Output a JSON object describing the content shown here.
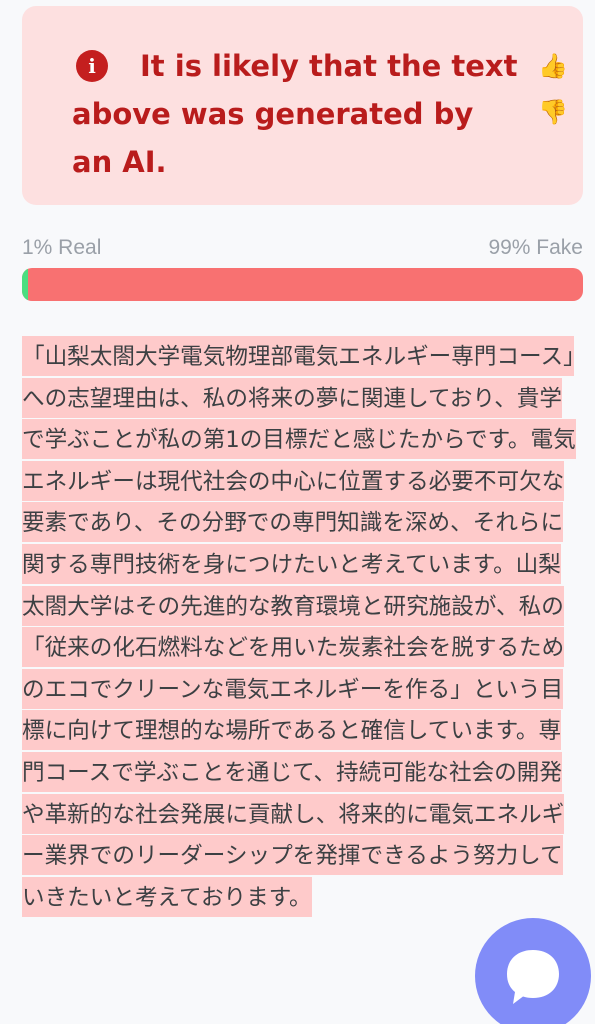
{
  "verdict": {
    "icon": "info-icon",
    "message": "It is likely that the text above was generated by an AI.",
    "accent_color": "#b91c1c",
    "background_color": "#fde0e0",
    "feedback": {
      "thumbs_up": "👍",
      "thumbs_down": "👎"
    }
  },
  "score": {
    "real_label": "1% Real",
    "fake_label": "99% Fake",
    "real_fraction": 0.01,
    "real_color": "#4ade80",
    "fake_color": "#f87171"
  },
  "analyzed_text": {
    "content": "「山梨太閤大学電気物理部電気エネルギー専門コース」への志望理由は、私の将来の夢に関連しており、貴学で学ぶことが私の第1の目標だと感じたからです。電気エネルギーは現代社会の中心に位置する必要不可欠な要素であり、その分野での専門知識を深め、それらに関する専門技術を身につけたいと考えています。山梨太閤大学はその先進的な教育環境と研究施設が、私の「従来の化石燃料などを用いた炭素社会を脱するためのエコでクリーンな電気エネルギーを作る」という目標に向けて理想的な場所であると確信しています。専門コースで学ぶことを通じて、持続可能な社会の開発や革新的な社会発展に貢献し、将来的に電気エネルギー業界でのリーダーシップを発揮できるよう努力していきたいと考えております。",
    "highlight_color": "#fecaca"
  },
  "chat": {
    "icon": "chat-bubble-icon",
    "color": "#818cf8"
  }
}
